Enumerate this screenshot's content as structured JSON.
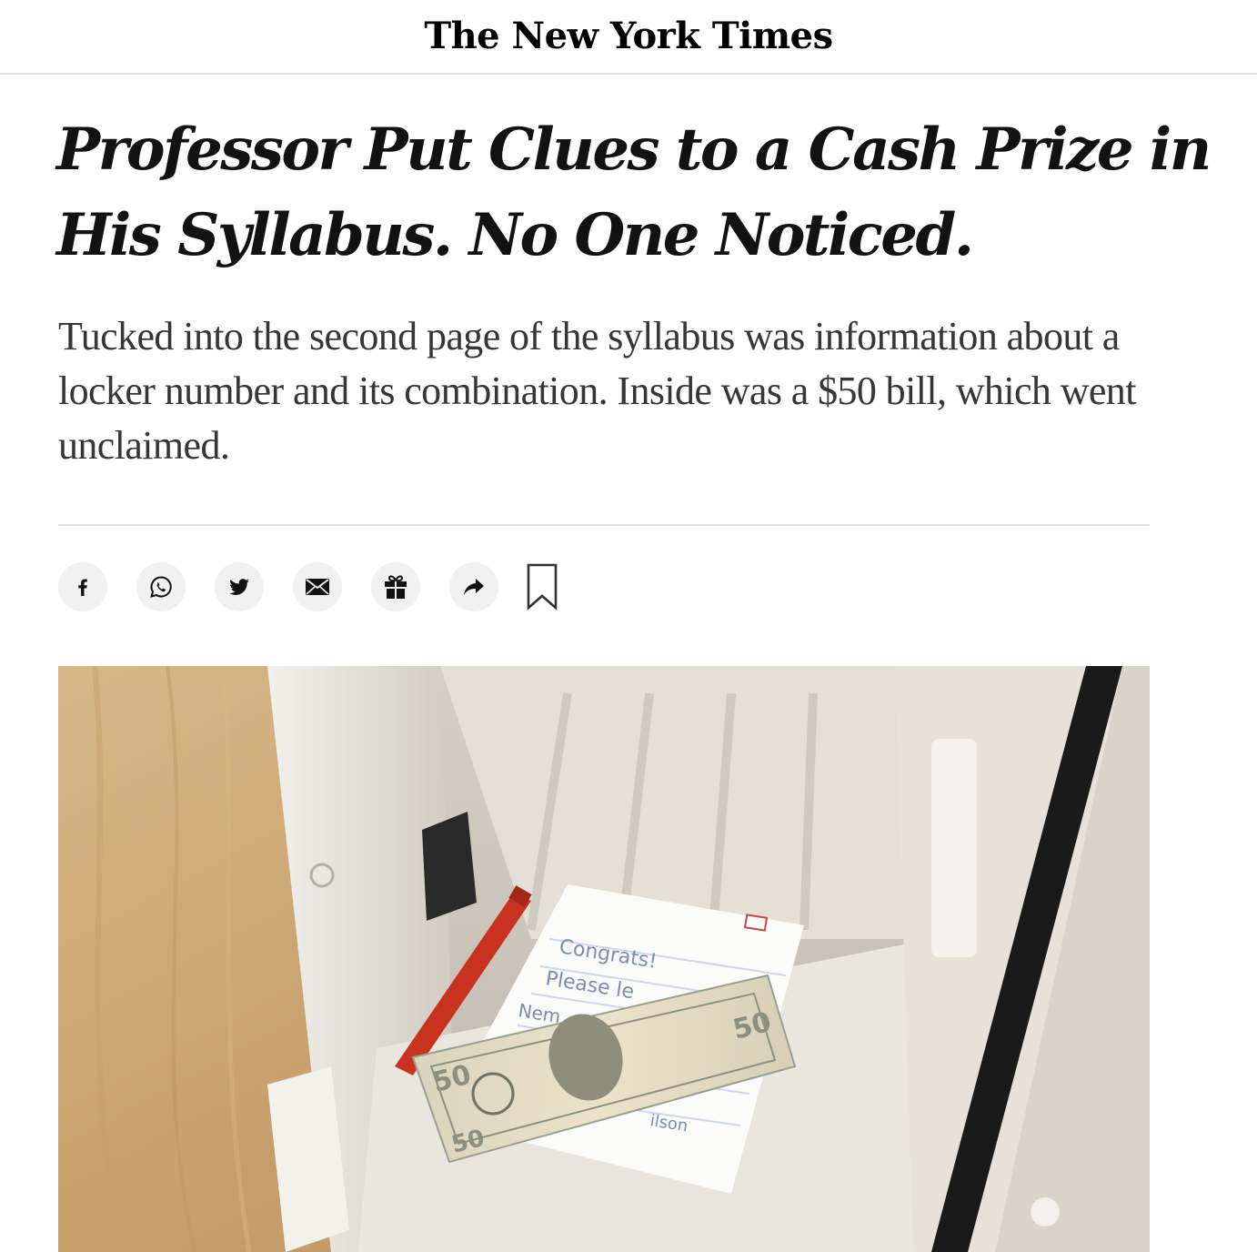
{
  "masthead": {
    "logo_text": "The New York Times"
  },
  "article": {
    "headline": "Professor Put Clues to a Cash Prize in His Syllabus. No One Noticed.",
    "summary": "Tucked into the second page of the syllabus was information about a locker number and its combination. Inside was a $50 bill, which went unclaimed."
  },
  "share_bar": {
    "buttons": [
      {
        "icon": "facebook-icon"
      },
      {
        "icon": "whatsapp-icon"
      },
      {
        "icon": "twitter-icon"
      },
      {
        "icon": "email-icon"
      },
      {
        "icon": "gift-icon"
      },
      {
        "icon": "share-arrow-icon"
      },
      {
        "icon": "bookmark-icon"
      }
    ]
  },
  "photo": {
    "note_text": [
      "Congrats!",
      "Please le",
      "Nem",
      "ilson"
    ],
    "bill_denomination": "50"
  },
  "colors": {
    "text": "#121212",
    "summary_text": "#363636",
    "divider": "#e2e2e2",
    "button_bg": "#f1f1f1"
  }
}
